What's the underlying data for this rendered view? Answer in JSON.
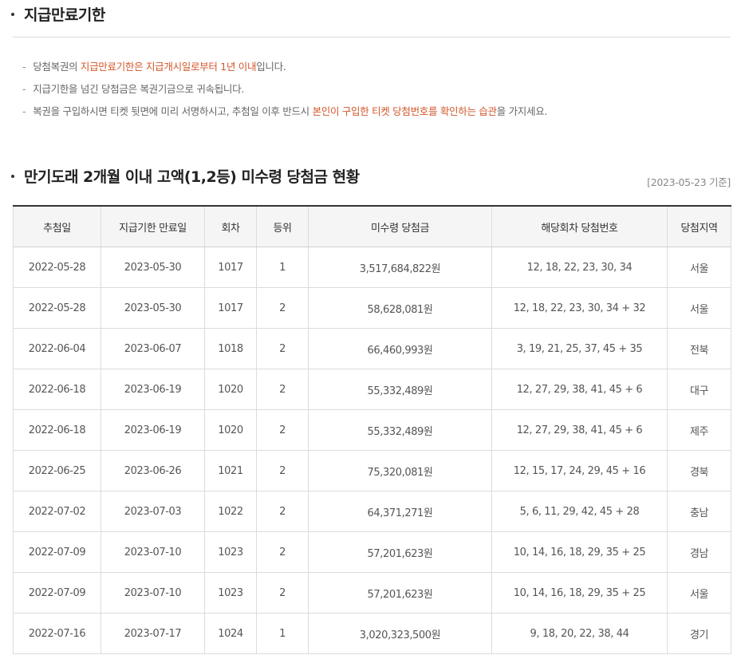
{
  "section1": {
    "title": "지급만료기한",
    "notes": [
      {
        "parts": [
          {
            "text": "당첨복권의 ",
            "hl": false
          },
          {
            "text": "지급만료기한은 지급개시일로부터 1년 이내",
            "hl": true
          },
          {
            "text": "입니다.",
            "hl": false
          }
        ]
      },
      {
        "parts": [
          {
            "text": "지급기한을 넘긴 당첨금은 복권기금으로 귀속됩니다.",
            "hl": false
          }
        ]
      },
      {
        "parts": [
          {
            "text": "복권을 구입하시면 티켓 뒷면에 미리 서명하시고, 추첨일 이후 반드시 ",
            "hl": false
          },
          {
            "text": "본인이 구입한 티켓 당첨번호를 확인하는 습관",
            "hl": true
          },
          {
            "text": "을 가지세요.",
            "hl": false
          }
        ]
      }
    ]
  },
  "section2": {
    "title": "만기도래 2개월 이내 고액(1,2등) 미수령 당첨금 현황",
    "base_date": "[2023-05-23 기준]",
    "columns": [
      "추첨일",
      "지급기한 만료일",
      "회차",
      "등위",
      "미수령 당첨금",
      "해당회차 당첨번호",
      "당첨지역"
    ],
    "rows": [
      [
        "2022-05-28",
        "2023-05-30",
        "1017",
        "1",
        "3,517,684,822원",
        "12, 18, 22, 23, 30, 34",
        "서울"
      ],
      [
        "2022-05-28",
        "2023-05-30",
        "1017",
        "2",
        "58,628,081원",
        "12, 18, 22, 23, 30, 34 + 32",
        "서울"
      ],
      [
        "2022-06-04",
        "2023-06-07",
        "1018",
        "2",
        "66,460,993원",
        "3, 19, 21, 25, 37, 45 + 35",
        "전북"
      ],
      [
        "2022-06-18",
        "2023-06-19",
        "1020",
        "2",
        "55,332,489원",
        "12, 27, 29, 38, 41, 45 + 6",
        "대구"
      ],
      [
        "2022-06-18",
        "2023-06-19",
        "1020",
        "2",
        "55,332,489원",
        "12, 27, 29, 38, 41, 45 + 6",
        "제주"
      ],
      [
        "2022-06-25",
        "2023-06-26",
        "1021",
        "2",
        "75,320,081원",
        "12, 15, 17, 24, 29, 45 + 16",
        "경북"
      ],
      [
        "2022-07-02",
        "2023-07-03",
        "1022",
        "2",
        "64,371,271원",
        "5, 6, 11, 29, 42, 45 + 28",
        "충남"
      ],
      [
        "2022-07-09",
        "2023-07-10",
        "1023",
        "2",
        "57,201,623원",
        "10, 14, 16, 18, 29, 35 + 25",
        "경남"
      ],
      [
        "2022-07-09",
        "2023-07-10",
        "1023",
        "2",
        "57,201,623원",
        "10, 14, 16, 18, 29, 35 + 25",
        "서울"
      ],
      [
        "2022-07-16",
        "2023-07-17",
        "1024",
        "1",
        "3,020,323,500원",
        "9, 18, 20, 22, 38, 44",
        "경기"
      ]
    ]
  },
  "colors": {
    "highlight": "#d2572a",
    "header_bg": "#f5f5f5",
    "border": "#dcdcdc"
  }
}
